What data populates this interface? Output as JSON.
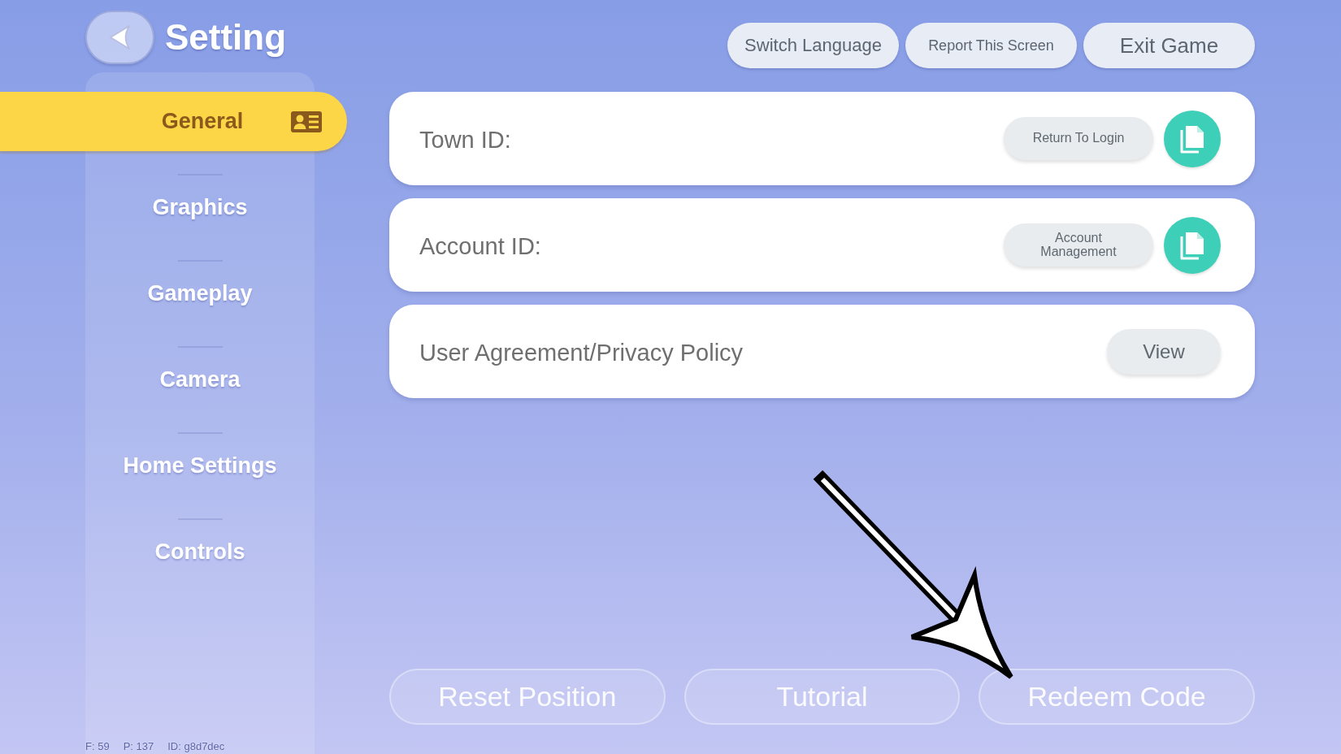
{
  "header": {
    "title": "Setting"
  },
  "top_buttons": [
    "Switch Language",
    "Report This Screen",
    "Exit Game"
  ],
  "sidebar": {
    "items": [
      {
        "label": "General",
        "selected": true
      },
      {
        "label": "Graphics",
        "selected": false
      },
      {
        "label": "Gameplay",
        "selected": false
      },
      {
        "label": "Camera",
        "selected": false
      },
      {
        "label": "Home Settings",
        "selected": false
      },
      {
        "label": "Controls",
        "selected": false
      }
    ]
  },
  "cards": [
    {
      "kind": "id",
      "label": "Town ID:",
      "button": "Return To Login"
    },
    {
      "kind": "id",
      "label": "Account ID:",
      "button": "Account Management"
    },
    {
      "kind": "link",
      "label": "User Agreement/Privacy Policy",
      "button": "View"
    }
  ],
  "bottom_buttons": [
    "Reset Position",
    "Tutorial",
    "Redeem Code"
  ],
  "debug_info": [
    "F: 59",
    "P: 137",
    "ID: g8d7dec"
  ]
}
